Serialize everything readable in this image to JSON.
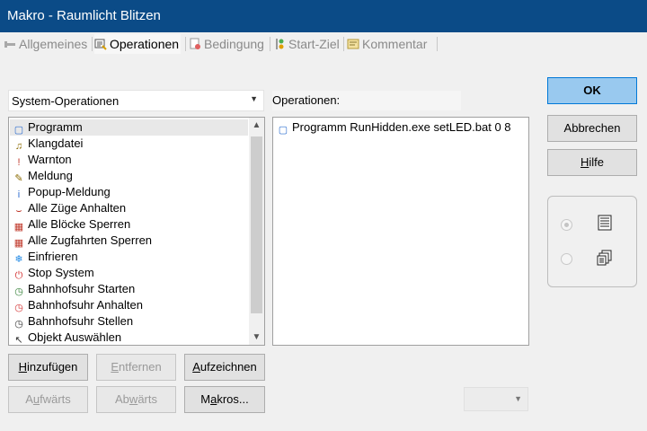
{
  "window": {
    "title": "Makro - Raumlicht Blitzen"
  },
  "tabs": [
    {
      "label": "Allgemeines",
      "icon": "wrench-icon",
      "active": false
    },
    {
      "label": "Operationen",
      "icon": "operations-icon",
      "active": true
    },
    {
      "label": "Bedingung",
      "icon": "condition-icon",
      "active": false
    },
    {
      "label": "Start-Ziel",
      "icon": "start-goal-icon",
      "active": false
    },
    {
      "label": "Kommentar",
      "icon": "comment-icon",
      "active": false
    }
  ],
  "category_select": {
    "value": "System-Operationen"
  },
  "operations_label": "Operationen:",
  "available_ops": [
    {
      "label": "Programm",
      "icon": "program-icon",
      "selected": true
    },
    {
      "label": "Klangdatei",
      "icon": "sound-icon",
      "selected": false
    },
    {
      "label": "Warnton",
      "icon": "warning-icon",
      "selected": false
    },
    {
      "label": "Meldung",
      "icon": "message-icon",
      "selected": false
    },
    {
      "label": "Popup-Meldung",
      "icon": "info-icon",
      "selected": false
    },
    {
      "label": "Alle Züge Anhalten",
      "icon": "halt-icon",
      "selected": false
    },
    {
      "label": "Alle Blöcke Sperren",
      "icon": "block-lock-icon",
      "selected": false
    },
    {
      "label": "Alle Zugfahrten Sperren",
      "icon": "route-lock-icon",
      "selected": false
    },
    {
      "label": "Einfrieren",
      "icon": "freeze-icon",
      "selected": false
    },
    {
      "label": "Stop System",
      "icon": "power-icon",
      "selected": false
    },
    {
      "label": "Bahnhofsuhr Starten",
      "icon": "clock-start-icon",
      "selected": false
    },
    {
      "label": "Bahnhofsuhr Anhalten",
      "icon": "clock-stop-icon",
      "selected": false
    },
    {
      "label": "Bahnhofsuhr Stellen",
      "icon": "clock-set-icon",
      "selected": false
    },
    {
      "label": "Objekt Auswählen",
      "icon": "cursor-icon",
      "selected": false
    }
  ],
  "macro_ops": [
    {
      "label": "Programm  RunHidden.exe setLED.bat 0 8",
      "icon": "program-icon"
    }
  ],
  "buttons": {
    "add": "Hinzufügen",
    "remove": "Entfernen",
    "record": "Aufzeichnen",
    "up": "Aufwärts",
    "down": "Abwärts",
    "macros": "Makros...",
    "ok": "OK",
    "cancel": "Abbrechen",
    "help": "Hilfe"
  },
  "bottom_select": {
    "value": ""
  },
  "view_mode": {
    "selected": "list"
  },
  "colors": {
    "titlebar": "#0b4b87",
    "ok_bg": "#99c9ef",
    "ok_border": "#0078d7"
  }
}
